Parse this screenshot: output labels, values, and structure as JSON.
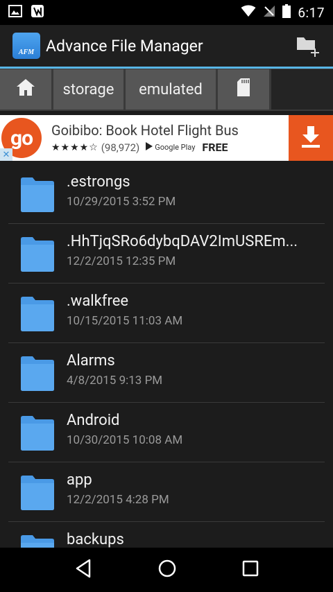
{
  "status_bar": {
    "time": "6:17"
  },
  "app_bar": {
    "logo_text": "AFM",
    "title": "Advance File Manager"
  },
  "breadcrumb": {
    "items": [
      {
        "label": "",
        "icon": "home-icon"
      },
      {
        "label": "storage"
      },
      {
        "label": "emulated"
      },
      {
        "label": "",
        "icon": "sd-card-icon"
      }
    ]
  },
  "ad": {
    "logo_text": "go",
    "title": "Goibibo: Book Hotel Flight Bus",
    "rating_stars": "★★★★☆",
    "rating_count": "(98,972)",
    "store": "Google Play",
    "price": "FREE",
    "close_label": "✕"
  },
  "files": [
    {
      "name": ".estrongs",
      "date": "10/29/2015 3:52 PM"
    },
    {
      "name": ".HhTjqSRo6dybqDAV2ImUSREm...",
      "date": "12/2/2015 12:35 PM"
    },
    {
      "name": ".walkfree",
      "date": "10/15/2015 11:03 AM"
    },
    {
      "name": "Alarms",
      "date": "4/8/2015 9:13 PM"
    },
    {
      "name": "Android",
      "date": "10/30/2015 10:08 AM"
    },
    {
      "name": "app",
      "date": "12/2/2015 4:28 PM"
    },
    {
      "name": "backups",
      "date": ""
    }
  ],
  "colors": {
    "accent": "#58b6e6",
    "folder": "#4a9ae6",
    "ad_orange": "#e8561f"
  }
}
